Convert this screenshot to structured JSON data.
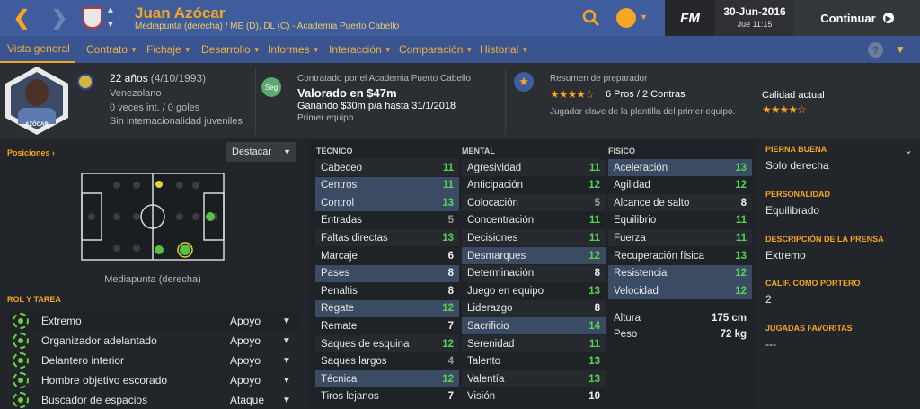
{
  "colors": {
    "accent": "#f5a623",
    "topbar": "#3f5d9c",
    "green": "#58d257"
  },
  "header": {
    "name": "Juan Azócar",
    "subtitle": "Mediapunta (derecha) / ME (D), DL (C) - Academia Puerto Cabello",
    "fm_logo": "FM",
    "date": "30-Jun-2016",
    "time": "Jue 11:15",
    "continue_label": "Continuar"
  },
  "menu": [
    {
      "label": "Vista general"
    },
    {
      "label": "Contrato"
    },
    {
      "label": "Fichaje"
    },
    {
      "label": "Desarrollo"
    },
    {
      "label": "Informes"
    },
    {
      "label": "Interacción"
    },
    {
      "label": "Comparación"
    },
    {
      "label": "Historial"
    }
  ],
  "help": "?",
  "profile": {
    "age": "22 años",
    "dob": "(4/10/1993)",
    "nationality": "Venezolano",
    "caps": "0 veces int. / 0 goles",
    "youth": "Sin internacionalidad juveniles",
    "photo_name": "AZÓCAR"
  },
  "contract": {
    "badge": "Seg",
    "label": "Contratado por el Academia Puerto Cabello",
    "value": "Valorado en $47m",
    "wage": "Ganando $30m p/a hasta 31/1/2018",
    "squad": "Primer equipo"
  },
  "coach": {
    "title": "Resumen de preparador",
    "stars": 4.5,
    "pros_cons": "6 Pros / 2 Contras",
    "summary": "Jugador clave de la plantilla del primer equipo.",
    "quality_label": "Calidad actual",
    "quality_stars": 4.5
  },
  "positions": {
    "title": "Posiciones",
    "highlight_label": "Destacar",
    "pitch_caption": "Mediapunta (derecha)"
  },
  "roles": {
    "title": "ROL Y TAREA",
    "items": [
      {
        "role": "Extremo",
        "duty": "Apoyo"
      },
      {
        "role": "Organizador adelantado",
        "duty": "Apoyo"
      },
      {
        "role": "Delantero interior",
        "duty": "Apoyo"
      },
      {
        "role": "Hombre objetivo escorado",
        "duty": "Apoyo"
      },
      {
        "role": "Buscador de espacios",
        "duty": "Ataque"
      }
    ]
  },
  "attributes": {
    "technical": {
      "title": "TÉCNICO",
      "items": [
        {
          "name": "Cabeceo",
          "value": "11"
        },
        {
          "name": "Centros",
          "value": "11"
        },
        {
          "name": "Control",
          "value": "13"
        },
        {
          "name": "Entradas",
          "value": "5"
        },
        {
          "name": "Faltas directas",
          "value": "13"
        },
        {
          "name": "Marcaje",
          "value": "6"
        },
        {
          "name": "Pases",
          "value": "8"
        },
        {
          "name": "Penaltis",
          "value": "8"
        },
        {
          "name": "Regate",
          "value": "12"
        },
        {
          "name": "Remate",
          "value": "7"
        },
        {
          "name": "Saques de esquina",
          "value": "12"
        },
        {
          "name": "Saques largos",
          "value": "4"
        },
        {
          "name": "Técnica",
          "value": "12"
        },
        {
          "name": "Tiros lejanos",
          "value": "7"
        }
      ]
    },
    "mental": {
      "title": "MENTAL",
      "items": [
        {
          "name": "Agresividad",
          "value": "11"
        },
        {
          "name": "Anticipación",
          "value": "12"
        },
        {
          "name": "Colocación",
          "value": "5"
        },
        {
          "name": "Concentración",
          "value": "11"
        },
        {
          "name": "Decisiones",
          "value": "11"
        },
        {
          "name": "Desmarques",
          "value": "12"
        },
        {
          "name": "Determinación",
          "value": "8"
        },
        {
          "name": "Juego en equipo",
          "value": "13"
        },
        {
          "name": "Liderazgo",
          "value": "8"
        },
        {
          "name": "Sacrificio",
          "value": "14"
        },
        {
          "name": "Serenidad",
          "value": "11"
        },
        {
          "name": "Talento",
          "value": "13"
        },
        {
          "name": "Valentía",
          "value": "13"
        },
        {
          "name": "Visión",
          "value": "10"
        }
      ]
    },
    "physical": {
      "title": "FÍSICO",
      "items": [
        {
          "name": "Aceleración",
          "value": "13"
        },
        {
          "name": "Agilidad",
          "value": "12"
        },
        {
          "name": "Alcance de salto",
          "value": "8"
        },
        {
          "name": "Equilibrio",
          "value": "11"
        },
        {
          "name": "Fuerza",
          "value": "11"
        },
        {
          "name": "Recuperación física",
          "value": "13"
        },
        {
          "name": "Resistencia",
          "value": "12"
        },
        {
          "name": "Velocidad",
          "value": "12"
        }
      ],
      "height_label": "Altura",
      "height": "175 cm",
      "weight_label": "Peso",
      "weight": "72 kg"
    }
  },
  "side": {
    "foot_label": "PIERNA BUENA",
    "foot": "Solo derecha",
    "personality_label": "PERSONALIDAD",
    "personality": "Equilibrado",
    "press_label": "DESCRIPCIÓN DE LA PRENSA",
    "press": "Extremo",
    "gk_label": "CALIF. COMO PORTERO",
    "gk": "2",
    "moves_label": "JUGADAS FAVORITAS",
    "moves": "---"
  }
}
